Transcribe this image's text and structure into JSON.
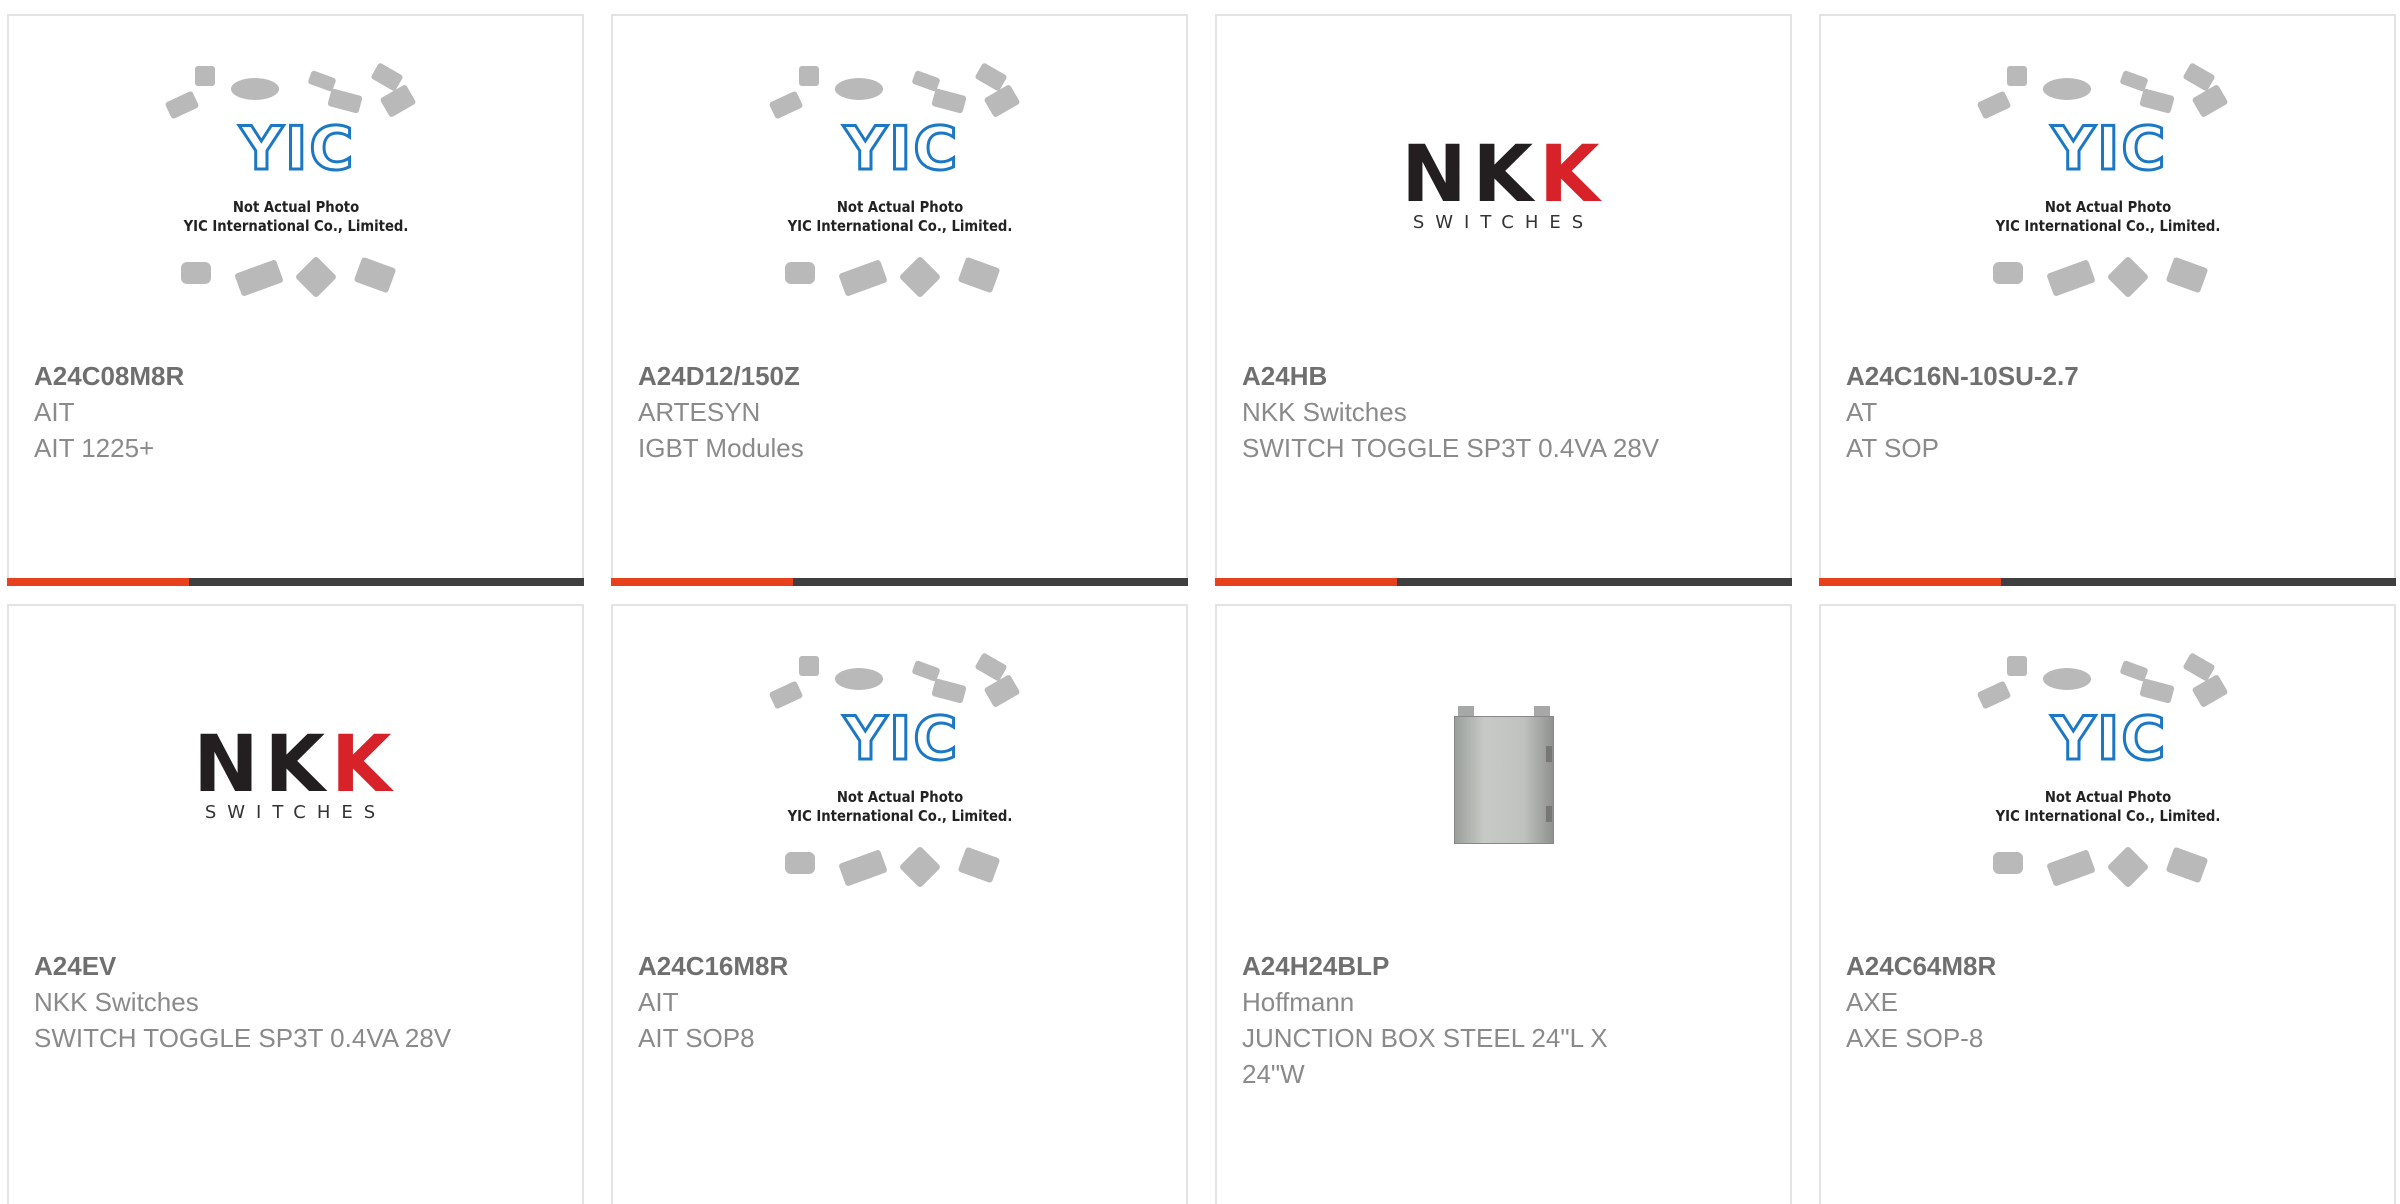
{
  "colors": {
    "accent": "#e8401c",
    "bar": "#3f3f3f",
    "nkk_black": "#231f20",
    "nkk_red": "#d7222a",
    "yic_blue": "#1c78c5"
  },
  "placeholder": {
    "letters": "YIC",
    "line1": "Not Actual Photo",
    "line2": "YIC International Co., Limited."
  },
  "nkk_logo": {
    "word_black": "NK",
    "word_red": "K",
    "sub": "SWITCHES"
  },
  "products": [
    {
      "part": "A24C08M8R",
      "manufacturer": "AIT",
      "description": "AIT 1225+",
      "image": "yic-placeholder"
    },
    {
      "part": "A24D12/150Z",
      "manufacturer": "ARTESYN",
      "description": "IGBT Modules",
      "image": "yic-placeholder"
    },
    {
      "part": "A24HB",
      "manufacturer": "NKK Switches",
      "description": "SWITCH TOGGLE SP3T 0.4VA 28V",
      "image": "nkk-logo"
    },
    {
      "part": "A24C16N-10SU-2.7",
      "manufacturer": "AT",
      "description": "AT SOP",
      "image": "yic-placeholder"
    },
    {
      "part": "A24EV",
      "manufacturer": "NKK Switches",
      "description": "SWITCH TOGGLE SP3T 0.4VA 28V",
      "image": "nkk-logo"
    },
    {
      "part": "A24C16M8R",
      "manufacturer": "AIT",
      "description": "AIT SOP8",
      "image": "yic-placeholder"
    },
    {
      "part": "A24H24BLP",
      "manufacturer": "Hoffmann",
      "description": "JUNCTION BOX STEEL 24\"L X 24\"W",
      "image": "enclosure-photo"
    },
    {
      "part": "A24C64M8R",
      "manufacturer": "AXE",
      "description": "AXE SOP-8",
      "image": "yic-placeholder"
    }
  ]
}
